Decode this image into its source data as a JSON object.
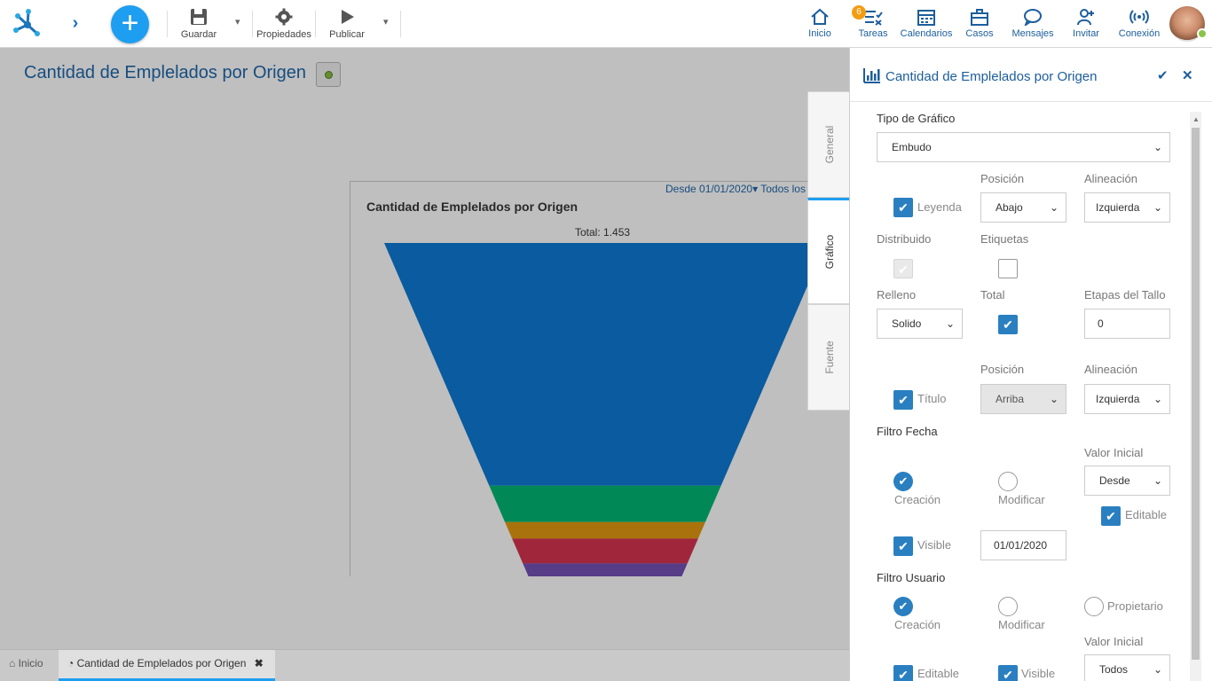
{
  "toolbar": {
    "save_label": "Guardar",
    "properties_label": "Propiedades",
    "publish_label": "Publicar"
  },
  "nav": [
    {
      "label": "Inicio",
      "icon": "home-icon"
    },
    {
      "label": "Tareas",
      "icon": "tasks-icon",
      "badge": "6"
    },
    {
      "label": "Calendarios",
      "icon": "calendar-icon"
    },
    {
      "label": "Casos",
      "icon": "briefcase-icon"
    },
    {
      "label": "Mensajes",
      "icon": "chat-icon"
    },
    {
      "label": "Invitar",
      "icon": "invite-user-icon"
    },
    {
      "label": "Conexión",
      "icon": "connection-icon"
    }
  ],
  "page": {
    "title": "Cantidad de Emplelados por Origen"
  },
  "chart_data": {
    "type": "funnel",
    "title": "Cantidad de Emplelados por Origen",
    "filter_label": "Desde 01/01/2020",
    "filter_user": "Todos los",
    "total_label": "Total: 1.453",
    "stages": [
      {
        "value": 1055,
        "color": "#0d6fc2"
      },
      {
        "value": 158,
        "color": "#00a86b"
      },
      {
        "value": 72,
        "color": "#d08b0f"
      },
      {
        "value": 108,
        "color": "#c43049"
      },
      {
        "value": 60,
        "color": "#6b4aa5"
      }
    ]
  },
  "side_tabs": {
    "general": "General",
    "grafico": "Gráfico",
    "fuente": "Fuente"
  },
  "panel": {
    "title": "Cantidad de Emplelados por Origen",
    "tipo_label": "Tipo de Gráfico",
    "tipo_value": "Embudo",
    "posicion_label": "Posición",
    "alineacion_label": "Alineación",
    "leyenda_label": "Leyenda",
    "leyenda_posicion": "Abajo",
    "leyenda_alineacion": "Izquierda",
    "distribuido_label": "Distribuido",
    "etiquetas_label": "Etiquetas",
    "relleno_label": "Relleno",
    "relleno_value": "Solido",
    "total_label": "Total",
    "etapas_label": "Etapas del Tallo",
    "etapas_value": "0",
    "posicion2_label": "Posición",
    "alineacion2_label": "Alineación",
    "titulo_label": "Título",
    "titulo_posicion": "Arriba",
    "titulo_alineacion": "Izquierda",
    "filtro_fecha_label": "Filtro Fecha",
    "valor_inicial_label": "Valor Inicial",
    "creacion_label": "Creación",
    "modificar_label": "Modificar",
    "valor_inicial_value": "Desde",
    "editable_label": "Editable",
    "visible_label": "Visible",
    "fecha_value": "01/01/2020",
    "filtro_usuario_label": "Filtro Usuario",
    "creacion2_label": "Creación",
    "modificar2_label": "Modificar",
    "propietario_label": "Propietario",
    "valor_inicial2_label": "Valor Inicial",
    "editable2_label": "Editable",
    "visible2_label": "Visible",
    "valor_inicial2_value": "Todos"
  },
  "bottom_tabs": {
    "inicio": "Inicio",
    "chart_tab": "Cantidad de Emplelados por Origen"
  }
}
